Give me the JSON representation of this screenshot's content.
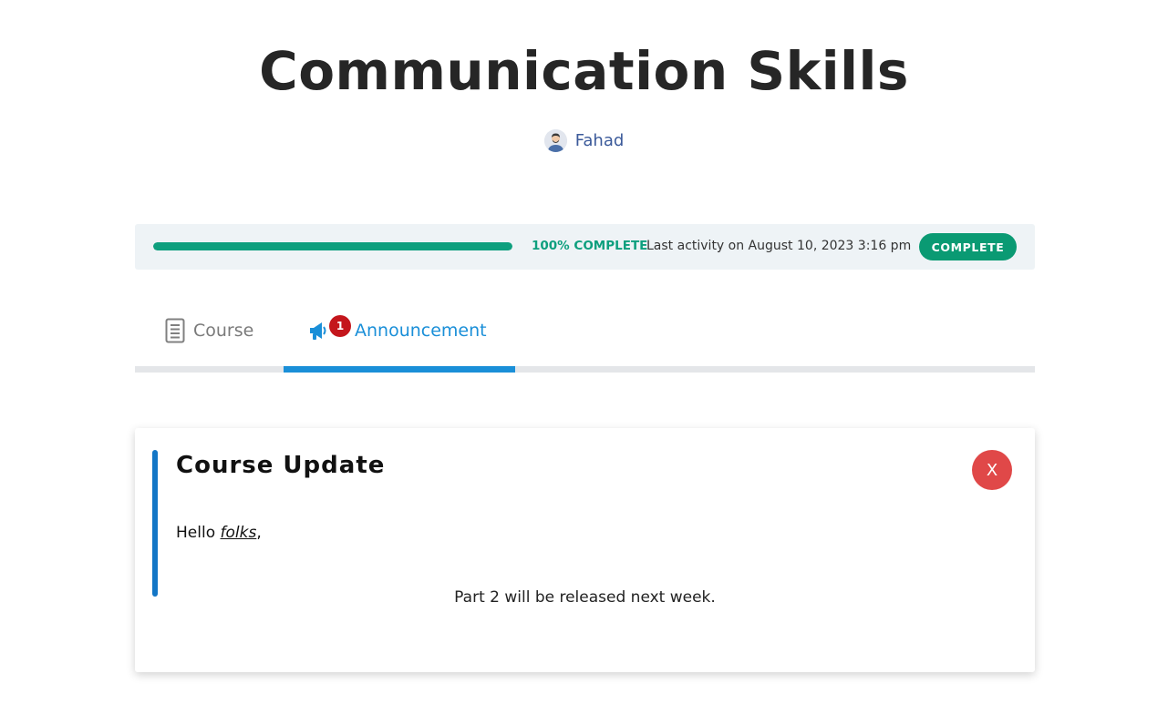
{
  "course": {
    "title": "Communication Skills",
    "author": "Fahad"
  },
  "progress": {
    "percent": 100,
    "percent_label": "100% COMPLETE",
    "last_activity": "Last activity on August 10, 2023 3:16 pm",
    "status_badge": "COMPLETE"
  },
  "tabs": [
    {
      "label": "Course",
      "icon": "document-icon",
      "active": false
    },
    {
      "label": "Announcement",
      "icon": "megaphone-icon",
      "active": true,
      "badge": "1"
    }
  ],
  "announcement": {
    "title": "Course Update",
    "close_label": "X",
    "greeting_prefix": "Hello ",
    "greeting_name": "folks",
    "greeting_suffix": ",",
    "body": "Part 2 will be released next week."
  },
  "colors": {
    "progress": "#0e9f7e",
    "tab_active": "#1a8fd8",
    "badge": "#c4161c",
    "close": "#e04848",
    "accent": "#1376c6"
  }
}
